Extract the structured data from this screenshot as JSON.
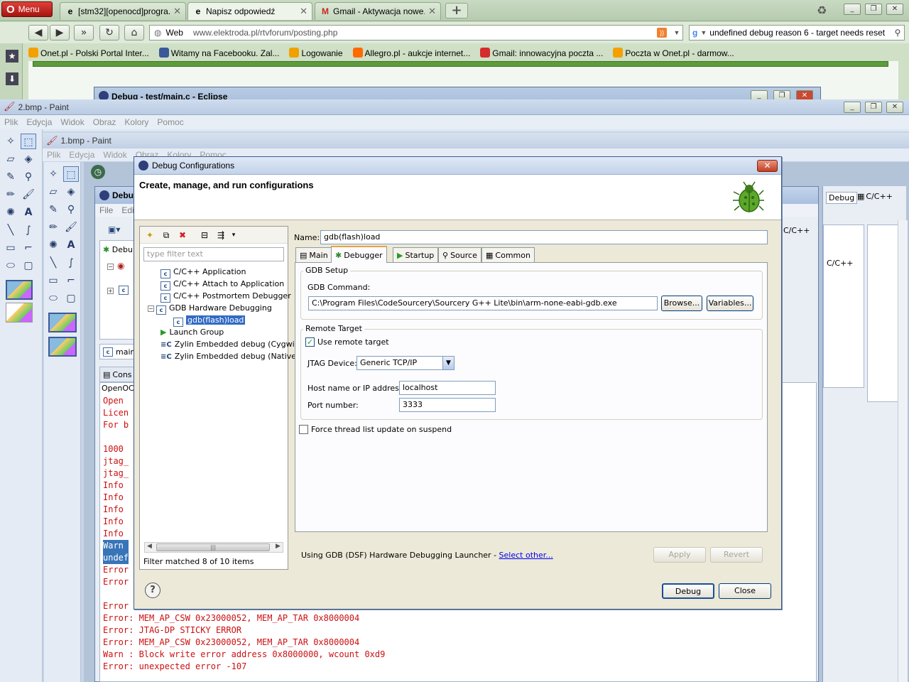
{
  "browser": {
    "menu_label": "Menu",
    "tabs": [
      {
        "title": "[stm32][openocd]progra...",
        "icon": "e"
      },
      {
        "title": "Napisz odpowiedź",
        "icon": "e"
      },
      {
        "title": "Gmail - Aktywacja nowe...",
        "icon": "M"
      }
    ],
    "new_tab": "+",
    "search_engine": "Web",
    "address": "www.elektroda.pl/rtvforum/posting.php",
    "search_text": "undefined debug reason 6 - target needs reset",
    "bookmarks": [
      {
        "label": "Onet.pl - Polski Portal Inter...",
        "color": "#f4a000"
      },
      {
        "label": "Witamy na Facebooku. Zal...",
        "color": "#3b5998"
      },
      {
        "label": "Logowanie",
        "color": "#f0a000"
      },
      {
        "label": "Allegro.pl - aukcje internet...",
        "color": "#ff6a00"
      },
      {
        "label": "Gmail: innowacyjna poczta ...",
        "color": "#d52d2d"
      },
      {
        "label": "Poczta w Onet.pl - darmow...",
        "color": "#f4a000"
      }
    ]
  },
  "eclipse_back_title": "Debug - test/main.c - Eclipse",
  "paint2": {
    "title": "2.bmp - Paint",
    "menu": [
      "Plik",
      "Edycja",
      "Widok",
      "Obraz",
      "Kolory",
      "Pomoc"
    ]
  },
  "paint1": {
    "title": "1.bmp - Paint",
    "menu": [
      "Plik",
      "Edycja",
      "Widok",
      "Obraz",
      "Kolory",
      "Pomoc"
    ]
  },
  "eclipse_inner": {
    "title": "Debu",
    "menu": [
      "File",
      "Edit"
    ],
    "left_item": "Debu",
    "main_tab": "main",
    "console_tab": "Cons",
    "console_header": "OpenOCD",
    "right_tabs": [
      "Debug",
      "C/C++",
      "C/C++",
      "C/C++"
    ]
  },
  "console_lines": [
    {
      "text": "Open ",
      "color": "red"
    },
    {
      "text": "Licen",
      "color": "red"
    },
    {
      "text": "For b",
      "color": "red"
    },
    {
      "text": "",
      "color": "red"
    },
    {
      "text": "1000 ",
      "color": "red"
    },
    {
      "text": "jtag_",
      "color": "red"
    },
    {
      "text": "jtag_",
      "color": "red"
    },
    {
      "text": "Info ",
      "color": "red"
    },
    {
      "text": "Info ",
      "color": "red"
    },
    {
      "text": "Info ",
      "color": "red"
    },
    {
      "text": "Info ",
      "color": "red"
    },
    {
      "text": "Info ",
      "color": "red"
    },
    {
      "text": "Warn ",
      "color": "sel"
    },
    {
      "text": "undef",
      "color": "sel"
    },
    {
      "text": "Error",
      "color": "red"
    },
    {
      "text": "Error",
      "color": "red"
    },
    {
      "text": "",
      "color": "red"
    },
    {
      "text": "Error",
      "color": "red"
    },
    {
      "text": "Error: MEM_AP_CSW 0x23000052, MEM_AP_TAR 0x8000004",
      "color": "red"
    },
    {
      "text": "Error: JTAG-DP STICKY ERROR",
      "color": "red"
    },
    {
      "text": "Error: MEM_AP_CSW 0x23000052, MEM_AP_TAR 0x8000004",
      "color": "red"
    },
    {
      "text": "Warn : Block write error address 0x8000000, wcount 0xd9",
      "color": "red"
    },
    {
      "text": "Error: unexpected error -107",
      "color": "red"
    }
  ],
  "dialog": {
    "title": "Debug Configurations",
    "heading": "Create, manage, and run configurations",
    "filter_placeholder": "type filter text",
    "tree": [
      {
        "label": "C/C++ Application",
        "icon": "c",
        "level": 1
      },
      {
        "label": "C/C++ Attach to Application",
        "icon": "c",
        "level": 1
      },
      {
        "label": "C/C++ Postmortem Debugger",
        "icon": "c",
        "level": 1
      },
      {
        "label": "GDB Hardware Debugging",
        "icon": "c",
        "level": 1,
        "expanded": true
      },
      {
        "label": "gdb(flash)load",
        "icon": "c",
        "level": 2,
        "selected": true
      },
      {
        "label": "Launch Group",
        "icon": "launch",
        "level": 1
      },
      {
        "label": "Zylin Embedded debug (Cygwin)",
        "icon": "zc",
        "level": 1
      },
      {
        "label": "Zylin Embedded debug (Native)",
        "icon": "zc",
        "level": 1
      }
    ],
    "filter_status": "Filter matched 8 of 10 items",
    "name_label": "Name:",
    "name_value": "gdb(flash)load",
    "tabs": [
      "Main",
      "Debugger",
      "Startup",
      "Source",
      "Common"
    ],
    "active_tab": "Debugger",
    "gdb_setup_label": "GDB Setup",
    "gdb_command_label": "GDB Command:",
    "gdb_command_value": "C:\\Program Files\\CodeSourcery\\Sourcery G++ Lite\\bin\\arm-none-eabi-gdb.exe",
    "browse_label": "Browse...",
    "variables_label": "Variables...",
    "remote_target_label": "Remote Target",
    "use_remote_label": "Use remote target",
    "use_remote_checked": true,
    "jtag_label": "JTAG Device:",
    "jtag_value": "Generic TCP/IP",
    "host_label": "Host name or IP address:",
    "host_value": "localhost",
    "port_label": "Port number:",
    "port_value": "3333",
    "force_thread_label": "Force thread list update on suspend",
    "force_thread_checked": false,
    "launcher_text": "Using GDB (DSF) Hardware Debugging Launcher - ",
    "select_other": "Select other...",
    "apply_label": "Apply",
    "revert_label": "Revert",
    "debug_label": "Debug",
    "close_label": "Close"
  }
}
